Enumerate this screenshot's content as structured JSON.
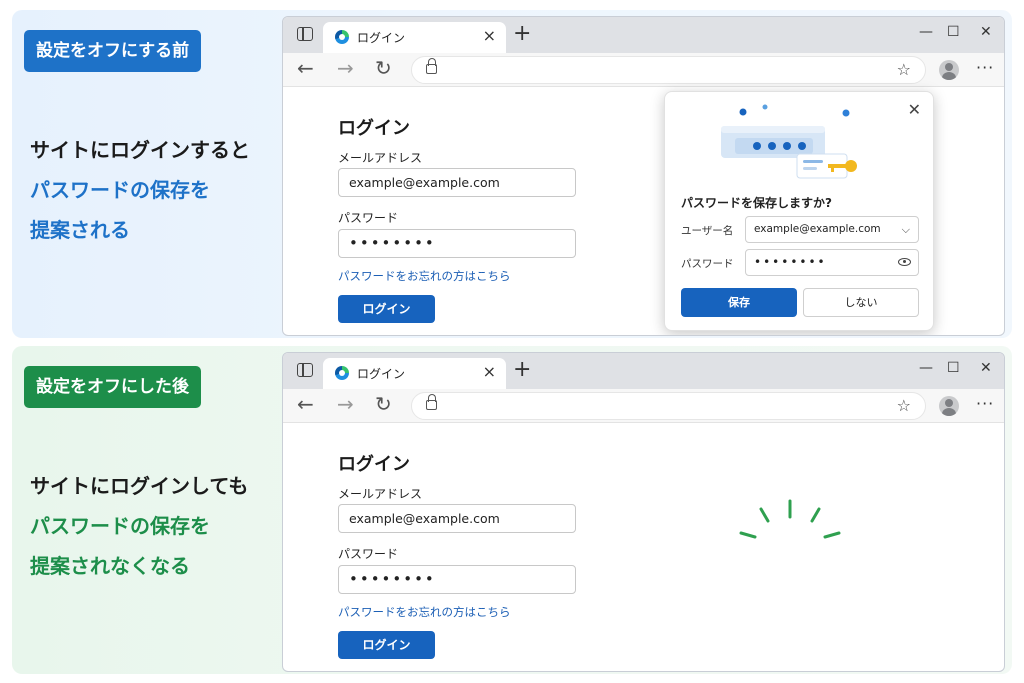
{
  "colors": {
    "blue": "#1e72c8",
    "green": "#1d8e4a",
    "button_blue": "#1763be",
    "link_blue": "#1c5fb5"
  },
  "before": {
    "badge": "設定をオフにする前",
    "caption_line1": "サイトにログインすると",
    "caption_line2": "パスワードの保存を",
    "caption_line3": "提案される"
  },
  "after": {
    "badge": "設定をオフにした後",
    "caption_line1": "サイトにログインしても",
    "caption_line2": "パスワードの保存を",
    "caption_line3": "提案されなくなる"
  },
  "browser": {
    "tab_title": "ログイン",
    "tab_close": "×",
    "new_tab": "+",
    "minimize": "—",
    "maximize": "☐",
    "close": "✕",
    "back": "←",
    "forward": "→",
    "reload": "↻",
    "favorites": "☆",
    "more": "···",
    "icons": [
      "edge-icon",
      "lock-icon",
      "favorites-icon",
      "profile-icon"
    ]
  },
  "login_form": {
    "title": "ログイン",
    "email_label": "メールアドレス",
    "email_value": "example@example.com",
    "password_label": "パスワード",
    "password_value": "••••••••",
    "forgot_link": "パスワードをお忘れの方はこちら",
    "login_button": "ログイン"
  },
  "save_popup": {
    "close": "✕",
    "title": "パスワードを保存しますか?",
    "username_label": "ユーザー名",
    "username_value": "example@example.com",
    "password_label": "パスワード",
    "password_value": "••••••••",
    "save_button": "保存",
    "dismiss_button": "しない"
  }
}
